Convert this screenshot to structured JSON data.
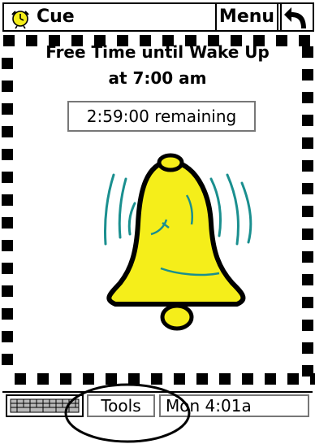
{
  "app": {
    "title": "Cue",
    "menu_label": "Menu",
    "icon": "alarm-clock-icon"
  },
  "reminder": {
    "line1": "Free Time until Wake Up",
    "line2": "at 7:00 am",
    "remaining": "2:59:00 remaining"
  },
  "taskbar": {
    "keyboard_icon": "keyboard-icon",
    "tools_label": "Tools",
    "clock_text": "Mon 4:01a"
  },
  "colors": {
    "bell_fill": "#f5ee1a",
    "ring_lines": "#1a8f8f",
    "border": "#000000"
  }
}
